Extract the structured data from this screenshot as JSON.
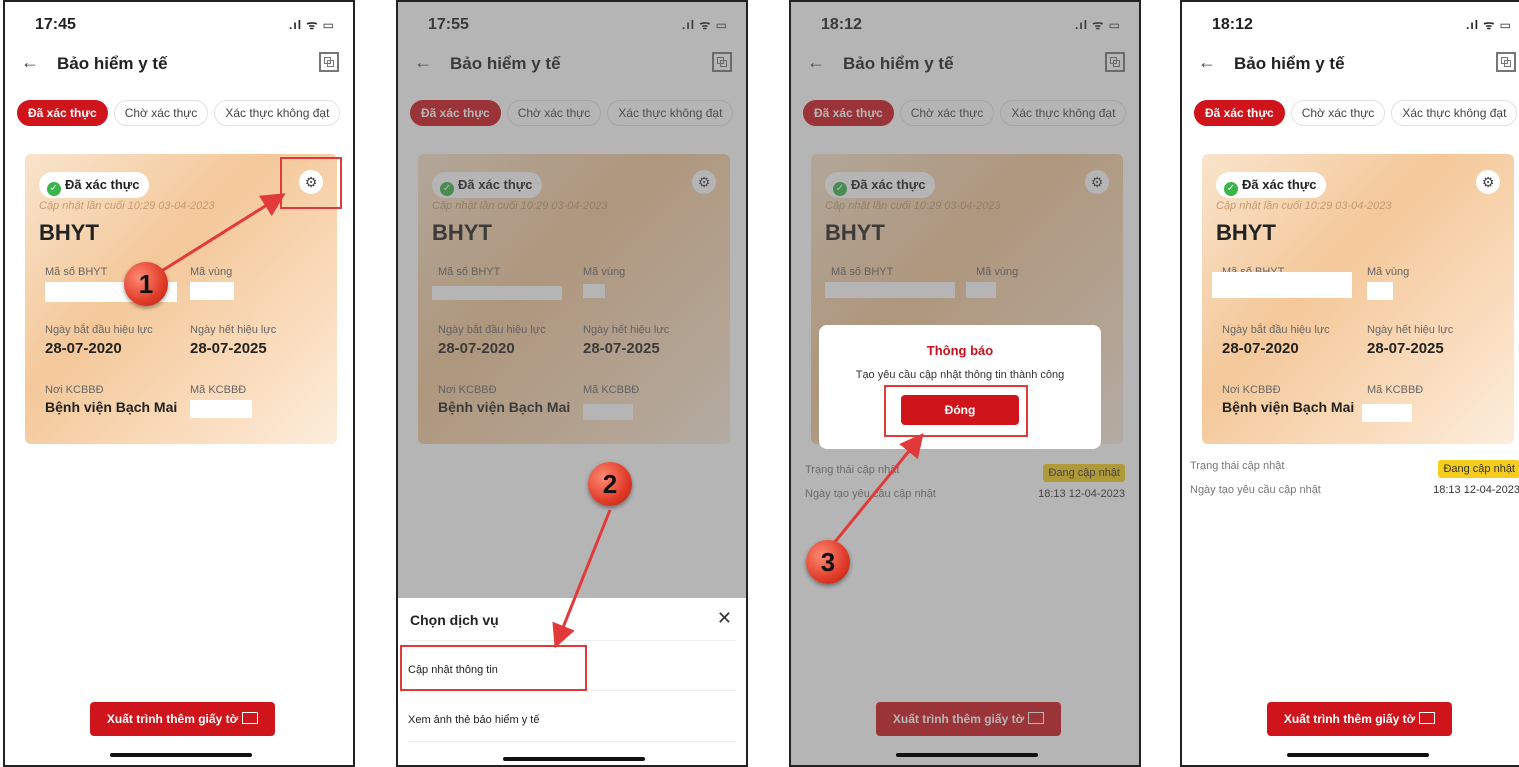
{
  "colors": {
    "accent": "#d0141c",
    "verified_green": "#3ab54a",
    "status_chip": "#f6cd1e",
    "highlight": "#e23a3a"
  },
  "common": {
    "screen_title": "Bảo hiểm y tế",
    "tabs": [
      "Đã xác thực",
      "Chờ xác thực",
      "Xác thực không đạt"
    ],
    "badge": "Đã xác thực",
    "updated_at": "Cập nhật lần cuối 10:29 03-04-2023",
    "card_title": "BHYT",
    "label_insurance_no": "Mã số BHYT",
    "label_region": "Mã vùng",
    "label_start": "Ngày bắt đầu hiệu lực",
    "label_end": "Ngày hết hiệu lực",
    "start_date": "28-07-2020",
    "end_date": "28-07-2025",
    "label_facility": "Nơi KCBBĐ",
    "label_facility_code": "Mã KCBBĐ",
    "facility": "Bệnh viện Bạch Mai",
    "present_button": "Xuất trình thêm giấy tờ",
    "status_label": "Trạng thái cập nhật",
    "status_value": "Đang cập nhật",
    "created_label": "Ngày tạo yêu cầu cập nhật",
    "created_value": "18:13 12-04-2023"
  },
  "phones": [
    {
      "time": "17:45",
      "signal": ".ıl ᯤ ▭"
    },
    {
      "time": "17:55",
      "signal": ".ıl ᯤ ▭"
    },
    {
      "time": "18:12",
      "signal": ".ıl ᯤ ▭"
    },
    {
      "time": "18:12",
      "signal": ".ıl ᯤ ▭"
    }
  ],
  "sheet": {
    "title": "Chọn dịch vụ",
    "items": [
      "Cập nhật thông tin",
      "Xem ảnh thẻ bảo hiểm y tế"
    ]
  },
  "dialog": {
    "title": "Thông báo",
    "message": "Tạo yêu cầu cập nhật thông tin thành công",
    "button": "Đóng"
  },
  "steps": [
    "1",
    "2",
    "3"
  ]
}
